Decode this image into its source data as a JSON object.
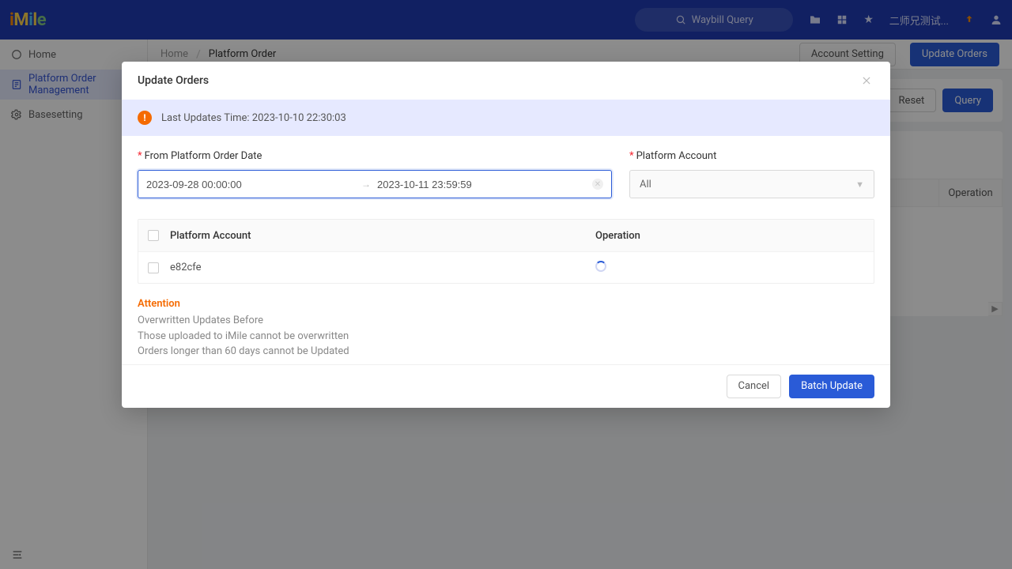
{
  "topbar": {
    "logo": "iMile",
    "search_placeholder": "Waybill Query",
    "username": "二师兄测试..."
  },
  "sidebar": {
    "items": [
      {
        "label": "Home"
      },
      {
        "label": "Platform Order Management"
      },
      {
        "label": "Basesetting"
      }
    ]
  },
  "breadcrumb": {
    "home": "Home",
    "current": "Platform Order"
  },
  "page_actions": {
    "account_setting": "Account Setting",
    "update_orders": "Update Orders",
    "reset": "Reset",
    "query": "Query"
  },
  "bg_table": {
    "operation_header": "Operation"
  },
  "modal": {
    "title": "Update Orders",
    "last_updates": "Last Updates Time: 2023-10-10 22:30:03",
    "form": {
      "date_label": "From Platform Order Date",
      "date_from": "2023-09-28 00:00:00",
      "date_to": "2023-10-11 23:59:59",
      "account_label": "Platform Account",
      "account_selected": "All"
    },
    "table": {
      "col_account": "Platform Account",
      "col_operation": "Operation",
      "rows": [
        {
          "account": "e82cfe"
        }
      ]
    },
    "attention": {
      "title": "Attention",
      "lines": [
        "Overwritten Updates Before",
        "Those uploaded to iMile cannot be overwritten",
        "Orders longer than 60 days cannot be Updated"
      ]
    },
    "footer": {
      "cancel": "Cancel",
      "batch_update": "Batch Update"
    }
  }
}
